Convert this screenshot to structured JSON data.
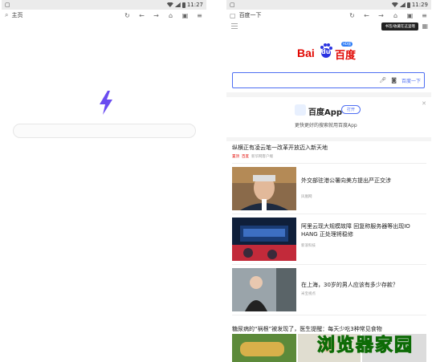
{
  "left": {
    "status": {
      "time": "11:27"
    },
    "toolbar": {
      "title": "主页"
    },
    "icons": [
      "search-icon",
      "refresh-icon",
      "back-icon",
      "forward-icon",
      "home-icon",
      "tabs-icon",
      "menu-icon"
    ]
  },
  "right": {
    "status": {
      "time": "11:29"
    },
    "toolbar": {
      "title": "百度一下"
    },
    "tooltip": "书签/收藏在这里哦",
    "logo": {
      "bai": "Bai",
      "du": "du",
      "cn": "百度",
      "tag": "HD版"
    },
    "search": {
      "button": "百度一下"
    },
    "app_card": {
      "name": "百度App",
      "open": "打开",
      "subtitle": "更快更好的搜索就用百度App"
    },
    "feed": {
      "headline": "纵横正有凌云笔一改革开放迈入新天地",
      "headline_meta": {
        "hot": "置顶",
        "tag": "百度",
        "source": "新华网客户端"
      },
      "items": [
        {
          "title": "外交部驻港公署向美方提出严正交涉",
          "source": "凤凰网"
        },
        {
          "title": "阿里云现大规模故障 回复称服务器等出现IO HANG 正处理将稳修",
          "source": "新浪科技"
        },
        {
          "title": "在上海，30岁的男人应该有多少存款？",
          "source": "米宝视点"
        }
      ],
      "last_title": "糖尿病的“祸根”被发现了，医生提醒：每天少吃3种常见食物"
    }
  },
  "watermark": "浏览器家园",
  "colors": {
    "baidu_red": "#e10601",
    "baidu_blue": "#4e6ef2",
    "bolt": "#6a4cf0",
    "watermark": "#3bd01c"
  }
}
